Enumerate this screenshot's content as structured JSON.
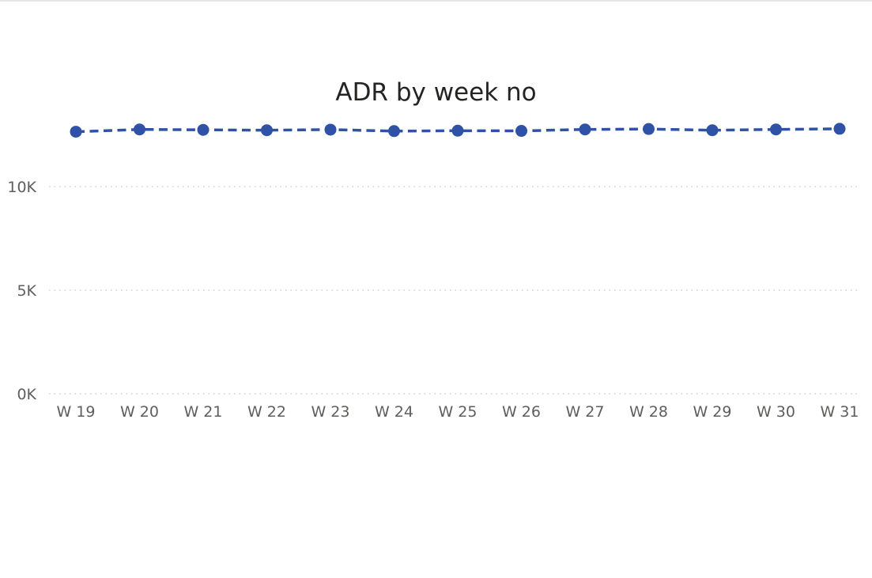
{
  "chart_data": {
    "type": "line",
    "title": "ADR by week no",
    "xlabel": "",
    "ylabel": "",
    "categories": [
      "W 19",
      "W 20",
      "W 21",
      "W 22",
      "W 23",
      "W 24",
      "W 25",
      "W 26",
      "W 27",
      "W 28",
      "W 29",
      "W 30",
      "W 31"
    ],
    "series": [
      {
        "color": "#2f52a7",
        "line_style": "dashed",
        "markers": true,
        "values": [
          12650,
          12760,
          12740,
          12720,
          12750,
          12680,
          12700,
          12690,
          12760,
          12780,
          12720,
          12760,
          12790
        ]
      }
    ],
    "y_ticks": [
      {
        "value": 0,
        "label": "0K"
      },
      {
        "value": 5000,
        "label": "5K"
      },
      {
        "value": 10000,
        "label": "10K"
      }
    ],
    "ylim": [
      0,
      14000
    ],
    "grid": "horizontal-dotted",
    "legend": "none"
  }
}
